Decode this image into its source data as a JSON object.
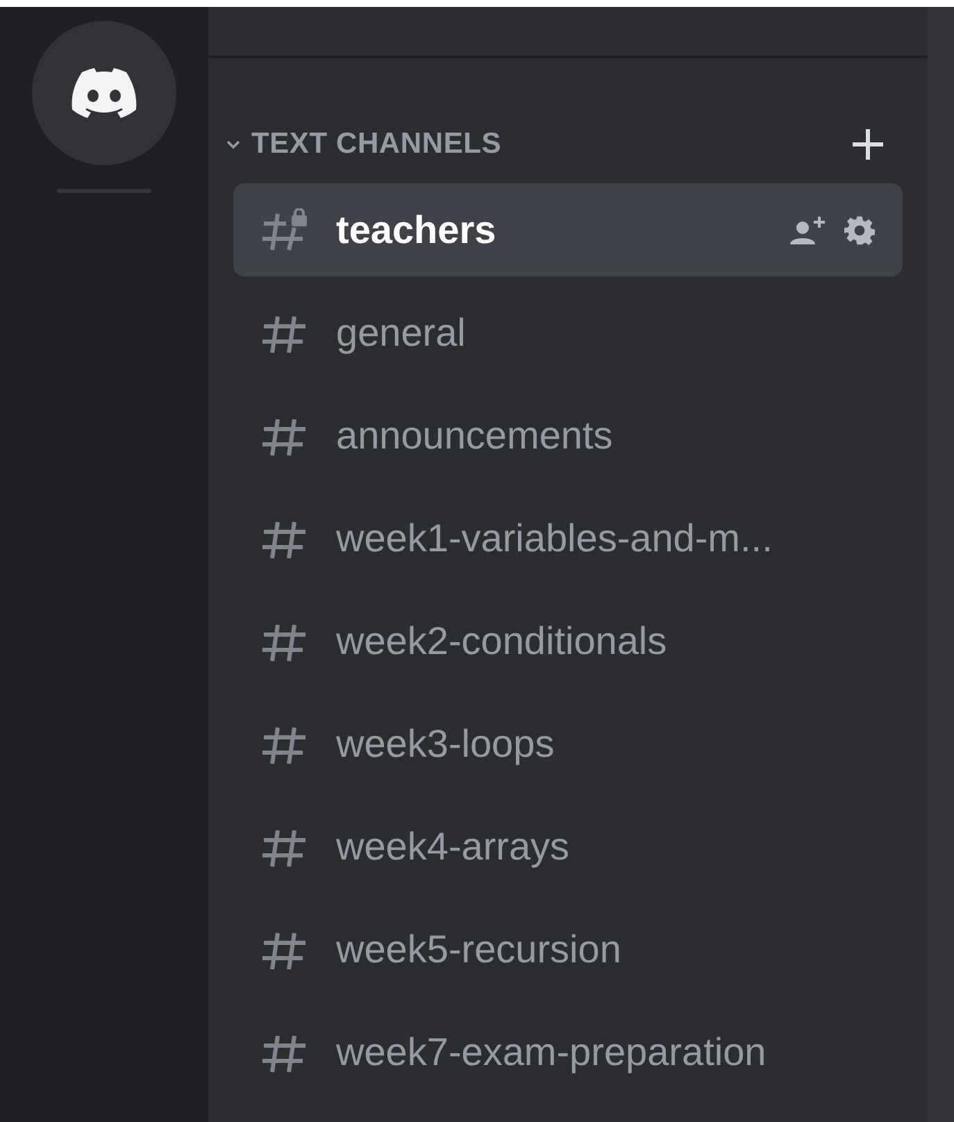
{
  "section": {
    "title": "TEXT CHANNELS",
    "expanded": true
  },
  "channels": [
    {
      "name": "teachers",
      "kind": "locked",
      "selected": true
    },
    {
      "name": "general",
      "kind": "text",
      "selected": false
    },
    {
      "name": "announcements",
      "kind": "text",
      "selected": false
    },
    {
      "name": "week1-variables-and-m...",
      "kind": "text",
      "selected": false
    },
    {
      "name": "week2-conditionals",
      "kind": "text",
      "selected": false
    },
    {
      "name": "week3-loops",
      "kind": "text",
      "selected": false
    },
    {
      "name": "week4-arrays",
      "kind": "text",
      "selected": false
    },
    {
      "name": "week5-recursion",
      "kind": "text",
      "selected": false
    },
    {
      "name": "week7-exam-preparation",
      "kind": "text",
      "selected": false
    }
  ]
}
